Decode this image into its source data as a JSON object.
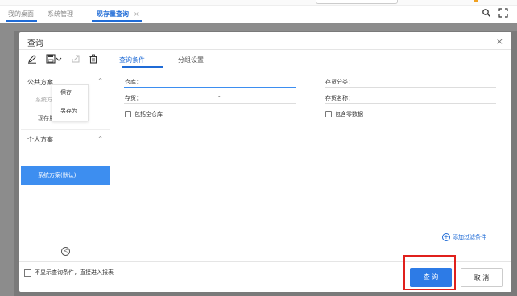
{
  "top_tabs": [
    {
      "label": "我的桌面"
    },
    {
      "label": "系统管理"
    },
    {
      "label": "现存量查询",
      "close": "×"
    }
  ],
  "dialog": {
    "title": "查询",
    "close": "×"
  },
  "left_panel": {
    "toolbar_icons": [
      "edit-icon",
      "save-icon",
      "export-icon",
      "delete-icon"
    ],
    "save_menu": [
      "保存",
      "另存为"
    ],
    "public_section": {
      "title": "公共方案",
      "arrow": "^"
    },
    "public_items": [
      "系统方案",
      "现存量查询"
    ],
    "personal_section": {
      "title": "个人方案",
      "arrow": "^"
    },
    "personal_items": [
      "系统方案(默认)"
    ],
    "collapse": "<"
  },
  "right_tabs": [
    "查询条件",
    "分组设置"
  ],
  "fields": {
    "warehouse": "仓库：",
    "inv_category": "存货分类：",
    "inventory": "存货：",
    "inventory_sep": "-",
    "inv_name": "存货名称：",
    "include_empty_wh": "包括空仓库",
    "include_zero": "包含零数据"
  },
  "add_filter": "添加过滤条件",
  "footer": {
    "skip_label": "不显示查询条件，直接进入报表",
    "query": "查 询",
    "cancel": "取 消"
  },
  "colors": {
    "accent": "#1f6bd6",
    "selected": "#3d8ef0",
    "highlight": "#e0201c"
  }
}
